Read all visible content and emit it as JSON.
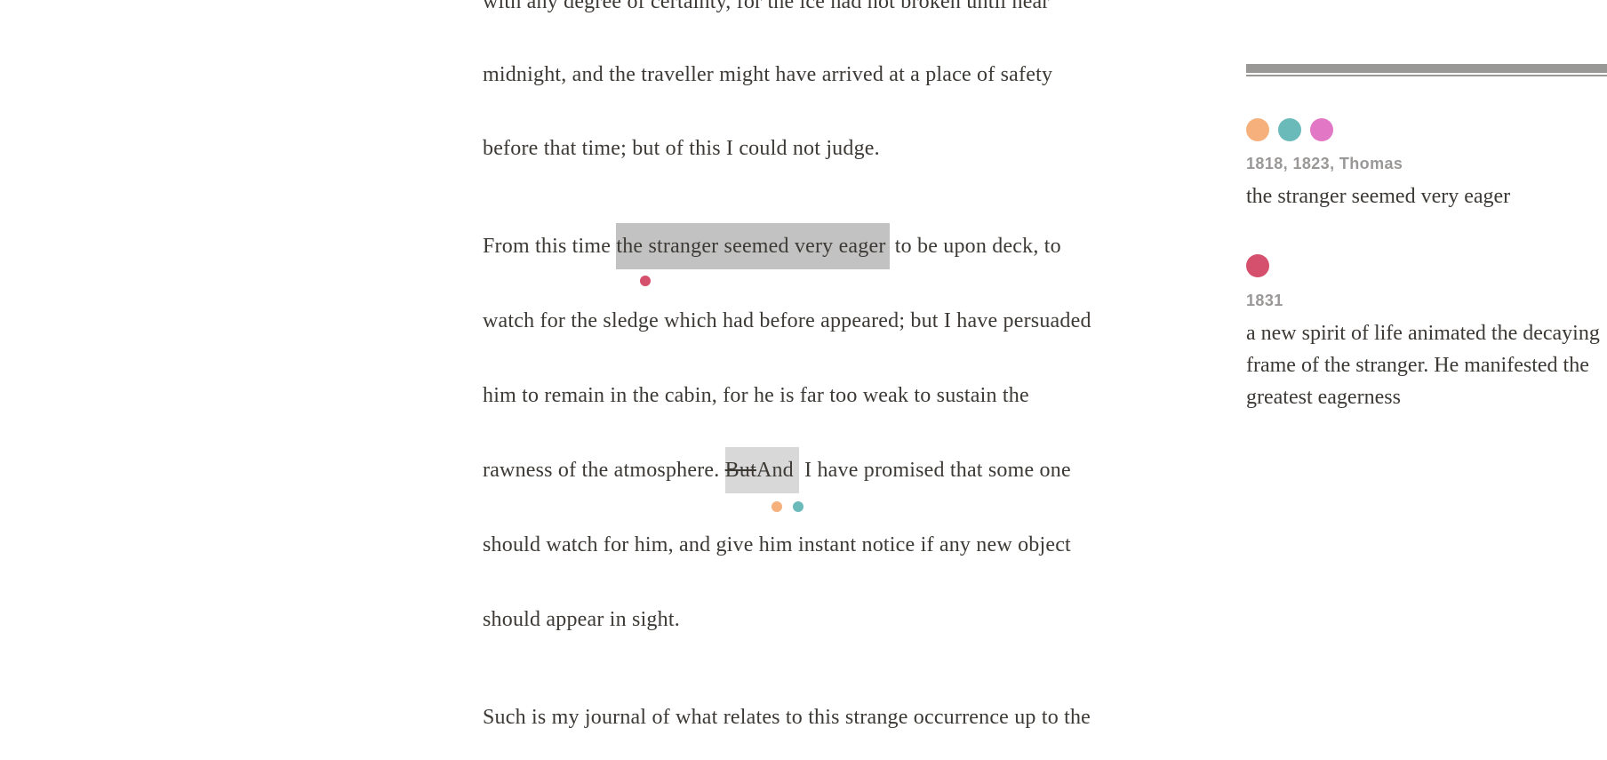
{
  "colors": {
    "orange": "#f6b07c",
    "teal": "#6bbaba",
    "pink": "#e277c6",
    "red": "#d4506d",
    "highlight_dark": "#c2c2c2",
    "highlight_light": "#d8d8d8",
    "sidebar_bar": "#9a9897"
  },
  "main": {
    "lines": [
      "with any degree of certainty, for the ice had not broken until near",
      "midnight, and the traveller might have arrived at a place of safety",
      "before that time; but of this I could not judge.",
      {
        "before": "From this time ",
        "highlight": "the stranger seemed very eager",
        "after": " to be upon deck, to"
      },
      "watch for the sledge which had before appeared; but I have persuaded",
      "him to remain in the cabin, for he is far too weak to sustain the",
      {
        "before": "rawness of the atmosphere. ",
        "struck": "But",
        "inserted": "And",
        "after": " I have promised that some one"
      },
      "should watch for him, and give him instant notice if any new object",
      "should appear in sight.",
      "Such is my journal of what relates to this strange occurrence up to the"
    ]
  },
  "sidebar": {
    "variants": [
      {
        "meta": "1818, 1823, Thomas",
        "text": "the stranger seemed very eager",
        "dot_colors": [
          "orange",
          "teal",
          "pink"
        ]
      },
      {
        "meta": "1831",
        "text": "a new spirit of life animated the decaying frame of the stranger. He manifested the greatest eagerness",
        "dot_colors": [
          "red"
        ]
      }
    ]
  }
}
